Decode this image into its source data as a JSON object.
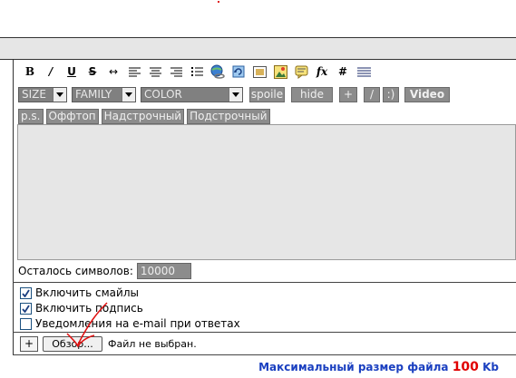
{
  "toolbar": {
    "format_buttons": [
      {
        "label": "B",
        "icon": "bold-icon"
      },
      {
        "label": "I",
        "icon": "italic-icon"
      },
      {
        "label": "U",
        "icon": "underline-icon"
      },
      {
        "label": "S",
        "icon": "strikethrough-icon"
      },
      {
        "label": "↔",
        "icon": "align-justify-arrows-icon"
      },
      {
        "label": "",
        "icon": "align-left-icon"
      },
      {
        "label": "",
        "icon": "align-center-icon"
      },
      {
        "label": "",
        "icon": "align-right-icon"
      },
      {
        "label": "",
        "icon": "list-icon"
      },
      {
        "label": "",
        "icon": "globe-link-icon"
      },
      {
        "label": "",
        "icon": "refresh-icon"
      },
      {
        "label": "",
        "icon": "image-icon"
      },
      {
        "label": "",
        "icon": "picture-icon"
      },
      {
        "label": "",
        "icon": "quote-icon"
      },
      {
        "label": "fx",
        "icon": "formula-icon"
      },
      {
        "label": "#",
        "icon": "hash-icon"
      },
      {
        "label": "",
        "icon": "code-lines-icon"
      }
    ],
    "size_select": "SIZE",
    "family_select": "FAMILY",
    "color_select": "COLOR",
    "spoiler_label": "spoile",
    "hide_label": "hide",
    "plus_label": "+",
    "slash_label": "/",
    "colon_label": ":",
    "paren_label": ")",
    "video_label": "Video",
    "ps_label": "p.s.",
    "offtop_label": "Оффтоп",
    "superscript_label": "Надстрочный",
    "subscript_label": "Подстрочный"
  },
  "editor": {
    "chars_left_label": "Осталось символов:",
    "chars_left_value": "10000"
  },
  "options": [
    {
      "label": "Включить смайлы",
      "checked": true
    },
    {
      "label": "Включить подпись",
      "checked": true
    },
    {
      "label": "Уведомления на e-mail при ответах",
      "checked": false
    }
  ],
  "attachment": {
    "plus_label": "+",
    "browse_label": "Обзор...",
    "status": "Файл не выбран."
  },
  "footer": {
    "max_size_prefix": "Максимальный размер файла",
    "max_size_value": "100",
    "max_size_unit": "Kb"
  },
  "colors": {
    "button_gray": "#8c8c8c",
    "editor_bg": "#e6e6e6",
    "info_blue": "#1a3fc0",
    "info_red": "#e00000"
  }
}
